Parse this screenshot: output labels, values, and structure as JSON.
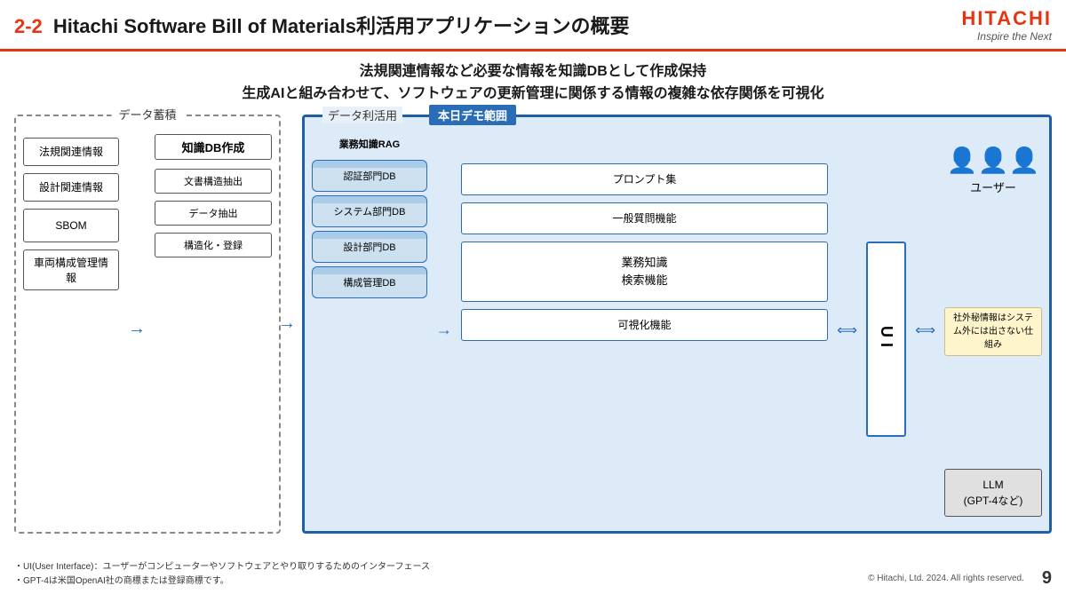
{
  "header": {
    "slide_number_prefix": "2-2",
    "title": " Hitachi Software Bill of Materials利活用アプリケーションの概要",
    "hitachi_brand": "HITACHI",
    "hitachi_tagline": "Inspire the Next"
  },
  "subtitle": {
    "line1": "法規関連情報など必要な情報を知識DBとして作成保持",
    "line2": "生成AIと組み合わせて、ソフトウェアの更新管理に関係する情報の複雑な依存関係を可視化"
  },
  "diagram": {
    "data_accumulation_label": "データ蓄積",
    "data_utilization_label": "データ利活用",
    "demo_badge": "本日デモ範囲",
    "input_items": [
      "法規関連情報",
      "設計関連情報",
      "SBOM",
      "車両構成管理情報"
    ],
    "knowledge_db": {
      "title": "知識DB作成",
      "steps": [
        "文書構造抽出",
        "データ抽出",
        "構造化・登録"
      ]
    },
    "rag_label": "業務知識RAG",
    "databases": [
      "認証部門DB",
      "システム部門DB",
      "設計部門DB",
      "構成管理DB"
    ],
    "functions": [
      "プロンプト集",
      "一般質問機能",
      "業務知識\n検索機能",
      "可視化機能"
    ],
    "ui_label": "UI",
    "user_label": "ユーザー",
    "secret_note": "社外秘情報はシステム外には出さない仕組み",
    "llm_label": "LLM\n(GPT-4など)"
  },
  "footer": {
    "notes": [
      "・UI(User Interface)：ユーザーがコンピューターやソフトウェアとやり取りするためのインターフェース",
      "・GPT-4は米国OpenAI社の商標または登録商標です。"
    ],
    "copyright": "© Hitachi, Ltd. 2024. All rights reserved.",
    "page": "9"
  }
}
